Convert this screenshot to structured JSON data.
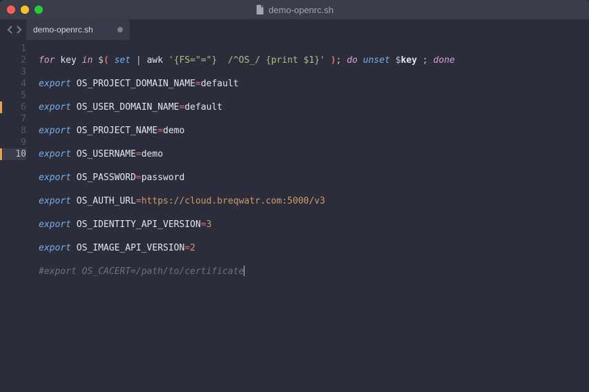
{
  "window": {
    "title": "demo-openrc.sh"
  },
  "tab": {
    "label": "demo-openrc.sh"
  },
  "editor": {
    "lines": [
      {
        "n": "1"
      },
      {
        "n": "2"
      },
      {
        "n": "3"
      },
      {
        "n": "4"
      },
      {
        "n": "5"
      },
      {
        "n": "6"
      },
      {
        "n": "7"
      },
      {
        "n": "8"
      },
      {
        "n": "9"
      },
      {
        "n": "10"
      }
    ],
    "diffmarks": [
      6,
      10
    ],
    "active_line": 10
  },
  "code": {
    "line1": {
      "for": "for",
      "key": "key",
      "in": "in",
      "dollar1": "$",
      "op1": "(",
      "set": "set",
      "pipe": "|",
      "awk": "awk",
      "str": "'{FS=\"=\"}  /^OS_/ {print $1}'",
      "op2": ")",
      "semi": ";",
      "do": "do",
      "unset": "unset",
      "dollar2": "$",
      "keyvar": "key",
      "semi2": ";",
      "done": "done"
    },
    "line2": {
      "export": "export",
      "var": "OS_PROJECT_DOMAIN_NAME",
      "eq": "=",
      "val": "default"
    },
    "line3": {
      "export": "export",
      "var": "OS_USER_DOMAIN_NAME",
      "eq": "=",
      "val": "default"
    },
    "line4": {
      "export": "export",
      "var": "OS_PROJECT_NAME",
      "eq": "=",
      "val": "demo"
    },
    "line5": {
      "export": "export",
      "var": "OS_USERNAME",
      "eq": "=",
      "val": "demo"
    },
    "line6": {
      "export": "export",
      "var": "OS_PASSWORD",
      "eq": "=",
      "val": "password"
    },
    "line7": {
      "export": "export",
      "var": "OS_AUTH_URL",
      "eq": "=",
      "val": "https://cloud.breqwatr.com:5000/v3"
    },
    "line8": {
      "export": "export",
      "var": "OS_IDENTITY_API_VERSION",
      "eq": "=",
      "val": "3"
    },
    "line9": {
      "export": "export",
      "var": "OS_IMAGE_API_VERSION",
      "eq": "=",
      "val": "2"
    },
    "line10": {
      "comment": "#export OS_CACERT=/path/to/certificate"
    }
  }
}
